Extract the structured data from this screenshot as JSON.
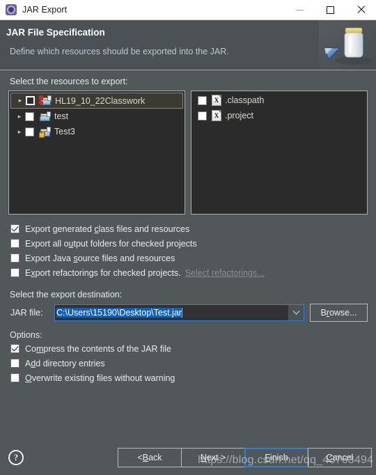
{
  "window": {
    "title": "JAR Export",
    "icon": "jar-export-icon",
    "controls": {
      "minimize": "minimize",
      "maximize": "maximize",
      "close": "close"
    }
  },
  "banner": {
    "title": "JAR File Specification",
    "subtitle": "Define which resources should be exported into the JAR.",
    "art": "jar-jar-icon"
  },
  "resources": {
    "label": "Select the resources to export:",
    "tree": [
      {
        "name": "HL19_10_22Classwork",
        "checked": false,
        "selected": true,
        "icon": "java-project-error-icon",
        "expander": "▸"
      },
      {
        "name": "test",
        "checked": false,
        "selected": false,
        "icon": "java-project-icon",
        "expander": "▸"
      },
      {
        "name": "Test3",
        "checked": false,
        "selected": false,
        "icon": "java-project-locked-icon",
        "expander": "▸"
      }
    ],
    "files": [
      {
        "name": ".classpath",
        "checked": false,
        "icon": "xml-file-icon",
        "glyph": "X"
      },
      {
        "name": ".project",
        "checked": false,
        "icon": "xml-file-icon",
        "glyph": "X"
      }
    ]
  },
  "export_options": [
    {
      "text_before": "Export generated ",
      "mnemonic": "c",
      "text_after": "lass files and resources",
      "checked": true
    },
    {
      "text_before": "Export all o",
      "mnemonic": "u",
      "text_after": "tput folders for checked projects",
      "checked": false
    },
    {
      "text_before": "Export Java ",
      "mnemonic": "s",
      "text_after": "ource files and resources",
      "checked": false
    },
    {
      "text_before": "E",
      "mnemonic": "x",
      "text_after": "port refactorings for checked projects.",
      "checked": false,
      "link": "Select refactorings..."
    }
  ],
  "destination": {
    "label": "Select the export destination:",
    "field_label": "JAR file:",
    "value": "C:\\Users\\15190\\Desktop\\Test.jar",
    "browse_before": "B",
    "browse_mnemonic": "r",
    "browse_after": "owse..."
  },
  "options": {
    "label": "Options:",
    "items": [
      {
        "text_before": "Co",
        "mnemonic": "m",
        "text_after": "press the contents of the JAR file",
        "checked": true
      },
      {
        "text_before": "A",
        "mnemonic": "d",
        "text_after": "d directory entries",
        "checked": false
      },
      {
        "text_before": "",
        "mnemonic": "O",
        "text_after": "verwrite existing files without warning",
        "checked": false
      }
    ]
  },
  "footer": {
    "help": "?",
    "buttons": [
      {
        "before": "< ",
        "mnemonic": "B",
        "after": "ack",
        "focused": false
      },
      {
        "before": "",
        "mnemonic": "N",
        "after": "ext >",
        "focused": false
      },
      {
        "before": "",
        "mnemonic": "F",
        "after": "inish",
        "focused": true
      },
      {
        "before": "",
        "mnemonic": "C",
        "after": "ancel",
        "focused": false
      }
    ]
  },
  "watermark": "https://blog.csdn.net/qq_43763494",
  "colors": {
    "dialog_bg": "#52585a",
    "banner_bg": "#4b5154",
    "pane_bg": "#2b2b2b",
    "titlebar_bg": "#ffffff",
    "accent_focus": "#2f7fd6",
    "selection_blue": "#0a63c4",
    "caret": "#e8a33d",
    "error_badge": "#d8202a",
    "lock_badge": "#d9a326"
  }
}
